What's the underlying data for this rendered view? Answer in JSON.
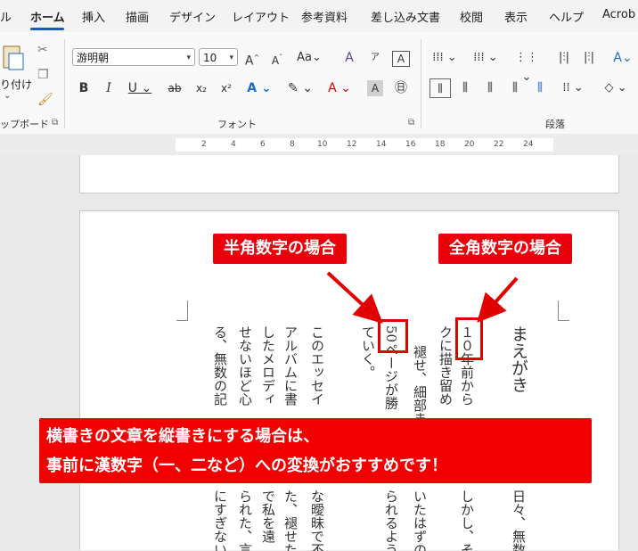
{
  "tabs": [
    "ル",
    "ホーム",
    "挿入",
    "描画",
    "デザイン",
    "レイアウト",
    "参考資料",
    "差し込み文書",
    "校閲",
    "表示",
    "ヘルプ",
    "Acrob"
  ],
  "clipboard": {
    "paste_label": "り付け",
    "group_label": "ップボード"
  },
  "font": {
    "name": "游明朝",
    "size": "10",
    "group_label": "フォント"
  },
  "paragraph": {
    "group_label": "段落"
  },
  "ruler_ticks": [
    "2",
    "4",
    "6",
    "8",
    "10",
    "12",
    "14",
    "16",
    "18",
    "20",
    "22",
    "24"
  ],
  "document": {
    "heading": "まえがき",
    "columns": [
      "１０年前から",
      "クに描き留め",
      "褪せ、細部ま",
      "ていく。",
      "50ページが勝",
      "このエッセイ",
      "アルバムに書",
      "したメロディ",
      "せないほど心",
      "る、無数の記"
    ],
    "lower_columns": [
      "日々、無数",
      "しかし、その",
      "いたはずの",
      "られるよう",
      "な曖昧で不",
      "た、褪せた",
      "で私を遠",
      "られた、言",
      "にすぎない。"
    ]
  },
  "callouts": {
    "halfwidth": "半角数字の場合",
    "fullwidth": "全角数字の場合"
  },
  "banner": {
    "line1": "横書きの文章を縦書きにする場合は、",
    "line2": "事前に漢数字（一、二など）への変換がおすすめです！"
  },
  "colors": {
    "accent": "#185abd",
    "callout_red": "#e8000b"
  }
}
